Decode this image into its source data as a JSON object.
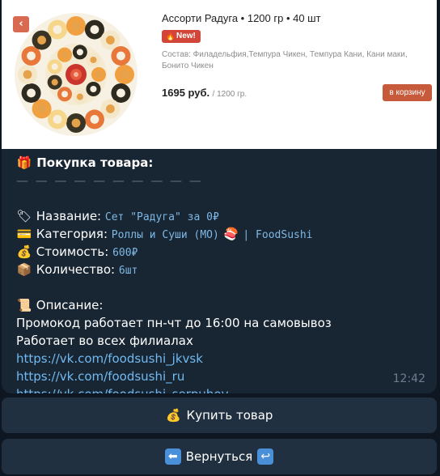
{
  "card": {
    "back_icon": "‹",
    "title": "Ассорти Радуга • 1200 гр • 40 шт",
    "badge": "New!",
    "composition": "Состав: Филадельфия,Темпура Чикен, Темпура Кани, Кани маки, Бонито Чикен",
    "price": "1695 руб.",
    "price_unit": "/ 1200 гр.",
    "cart_button": "в корзину"
  },
  "message": {
    "heading": "Покупка товара:",
    "divider": "— — — — — — — — — —",
    "name_label": "Название:",
    "name_value": "Сет \"Радуга\" за 0₽",
    "category_label": "Категория:",
    "category_value_a": "Роллы и Суши (МО)",
    "category_value_b": "| FoodSushi",
    "cost_label": "Стоимость:",
    "cost_value": "600₽",
    "qty_label": "Количество:",
    "qty_value": "6шт",
    "desc_label": "Описание:",
    "desc_line1": "Промокод работает пн-чт до 16:00 на самовывоз",
    "desc_line2": "Работает во всех филиалах",
    "links": [
      "https://vk.com/foodsushi_jkvsk",
      "https://vk.com/foodsushi_ru",
      "https://vk.com/foodsushi_serpuhov"
    ],
    "time": "12:42"
  },
  "buttons": {
    "buy_label": "Купить товар",
    "back_label": "Вернуться"
  },
  "icons": {
    "gift": "gift-icon",
    "label_tag": "label-icon",
    "card": "credit-card-icon",
    "money": "money-bag-icon",
    "box": "package-icon",
    "scroll": "scroll-icon",
    "sushi": "sushi-icon",
    "arrow_left": "arrow-left-icon",
    "return": "return-icon"
  },
  "colors": {
    "background": "#0e1621",
    "bubble": "#182533",
    "button": "#213040",
    "link": "#71baf1",
    "cart_button": "#c85a3c",
    "badge": "#d2463a"
  }
}
